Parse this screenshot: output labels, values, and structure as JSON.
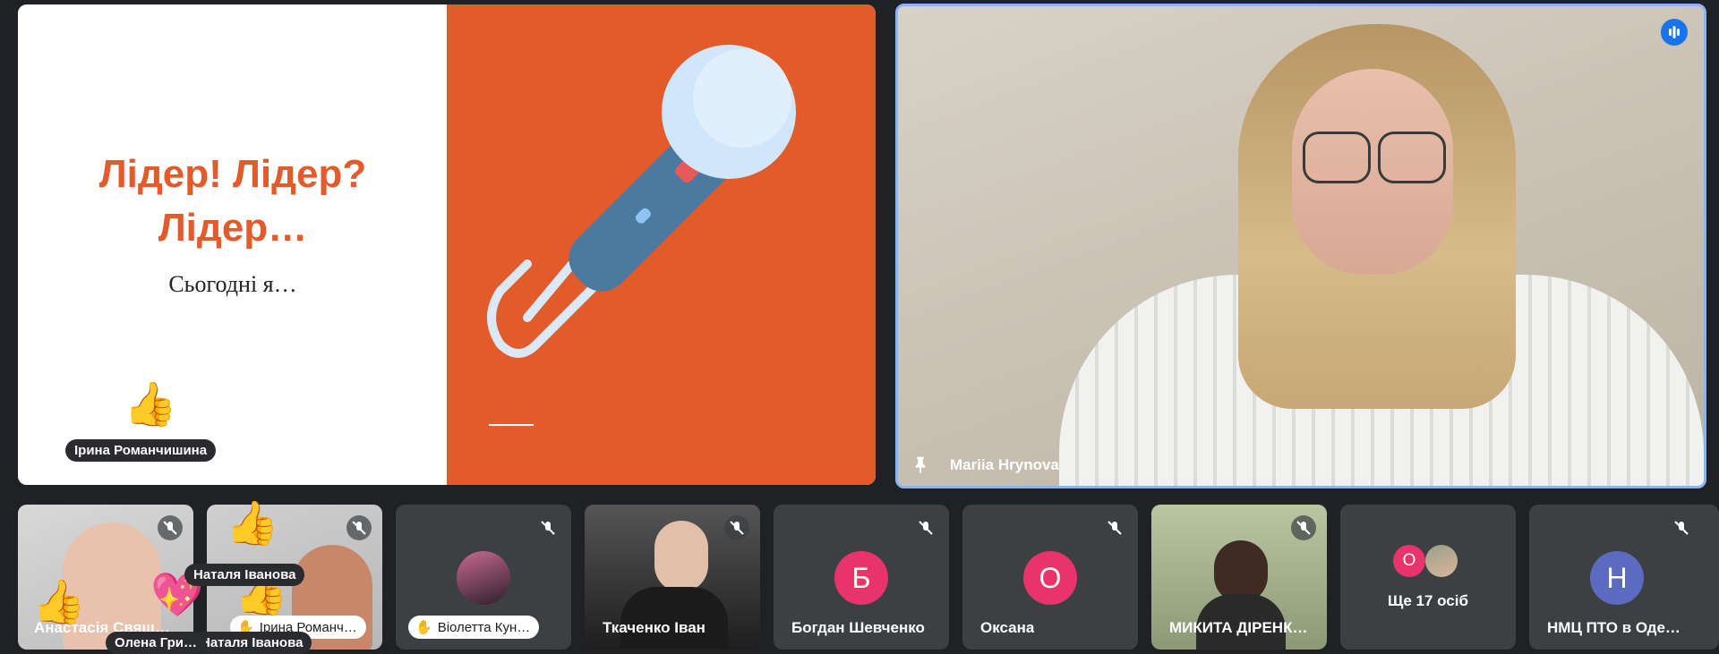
{
  "slide": {
    "title": "Лідер! Лідер? Лідер…",
    "subtitle": "Сьогодні я…",
    "reaction_name": "Ірина Романчишина"
  },
  "speaker": {
    "name": "Mariia Hrynova"
  },
  "reactions": {
    "name_1": "Наталя Іванова",
    "name_2": "Наталя Іванова",
    "name_3": "Олена Гри…"
  },
  "tiles": [
    {
      "name": "Анастасія Свящ…"
    },
    {
      "name": "Ірина Романч…"
    },
    {
      "name": "Віолетта Кун…"
    },
    {
      "name": "Ткаченко Іван"
    },
    {
      "name": "Богдан Шевченко",
      "initial": "Б",
      "color": "#e8336d"
    },
    {
      "name": "Оксана",
      "initial": "О",
      "color": "#e8336d"
    },
    {
      "name": "МИКИТА ДІРЕНК…"
    },
    {
      "name": "Ще 17 осіб",
      "initial": "О"
    },
    {
      "name": "НМЦ ПТО в Оде…",
      "initial": "Н",
      "color": "#5c6bc0"
    }
  ]
}
